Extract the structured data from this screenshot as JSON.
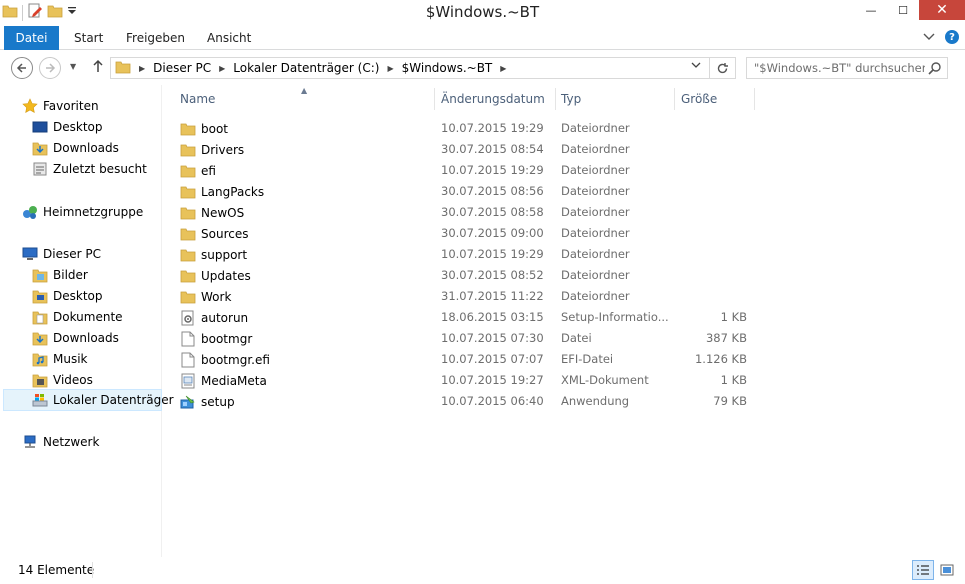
{
  "window": {
    "title": "$Windows.~BT",
    "minimize": "—",
    "maximize": "☐",
    "close": "✕"
  },
  "ribbon": {
    "tabs": [
      "Datei",
      "Start",
      "Freigeben",
      "Ansicht"
    ],
    "help": "?"
  },
  "address": {
    "crumbs": [
      "Dieser PC",
      "Lokaler Datenträger (C:)",
      "$Windows.~BT"
    ]
  },
  "search": {
    "placeholder": "\"$Windows.~BT\" durchsuchen"
  },
  "navpane": {
    "favorites": "Favoriten",
    "fav_items": [
      "Desktop",
      "Downloads",
      "Zuletzt besucht"
    ],
    "homegroup": "Heimnetzgruppe",
    "thispc": "Dieser PC",
    "pc_items": [
      "Bilder",
      "Desktop",
      "Dokumente",
      "Downloads",
      "Musik",
      "Videos",
      "Lokaler Datenträger"
    ],
    "network": "Netzwerk"
  },
  "columns": {
    "name": "Name",
    "date": "Änderungsdatum",
    "type": "Typ",
    "size": "Größe"
  },
  "files": [
    {
      "name": "boot",
      "date": "10.07.2015 19:29",
      "type": "Dateiordner",
      "size": "",
      "icon": "folder-icon"
    },
    {
      "name": "Drivers",
      "date": "30.07.2015 08:54",
      "type": "Dateiordner",
      "size": "",
      "icon": "folder-icon"
    },
    {
      "name": "efi",
      "date": "10.07.2015 19:29",
      "type": "Dateiordner",
      "size": "",
      "icon": "folder-icon"
    },
    {
      "name": "LangPacks",
      "date": "30.07.2015 08:56",
      "type": "Dateiordner",
      "size": "",
      "icon": "folder-icon"
    },
    {
      "name": "NewOS",
      "date": "30.07.2015 08:58",
      "type": "Dateiordner",
      "size": "",
      "icon": "folder-icon"
    },
    {
      "name": "Sources",
      "date": "30.07.2015 09:00",
      "type": "Dateiordner",
      "size": "",
      "icon": "folder-icon"
    },
    {
      "name": "support",
      "date": "10.07.2015 19:29",
      "type": "Dateiordner",
      "size": "",
      "icon": "folder-icon"
    },
    {
      "name": "Updates",
      "date": "30.07.2015 08:52",
      "type": "Dateiordner",
      "size": "",
      "icon": "folder-icon"
    },
    {
      "name": "Work",
      "date": "31.07.2015 11:22",
      "type": "Dateiordner",
      "size": "",
      "icon": "folder-icon"
    },
    {
      "name": "autorun",
      "date": "18.06.2015 03:15",
      "type": "Setup-Informatio...",
      "size": "1 KB",
      "icon": "setup-info-icon"
    },
    {
      "name": "bootmgr",
      "date": "10.07.2015 07:30",
      "type": "Datei",
      "size": "387 KB",
      "icon": "file-icon"
    },
    {
      "name": "bootmgr.efi",
      "date": "10.07.2015 07:07",
      "type": "EFI-Datei",
      "size": "1.126 KB",
      "icon": "file-icon"
    },
    {
      "name": "MediaMeta",
      "date": "10.07.2015 19:27",
      "type": "XML-Dokument",
      "size": "1 KB",
      "icon": "xml-icon"
    },
    {
      "name": "setup",
      "date": "10.07.2015 06:40",
      "type": "Anwendung",
      "size": "79 KB",
      "icon": "setup-app-icon"
    }
  ],
  "status": {
    "count": "14 Elemente"
  },
  "colors": {
    "accent": "#1979ca",
    "folder": "#e8c25a",
    "header_text": "#4c607a",
    "secondary_text": "#6d6d6d",
    "selection": "#e5f3fb"
  }
}
